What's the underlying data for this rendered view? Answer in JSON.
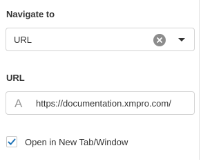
{
  "navigate_section": {
    "label": "Navigate to",
    "selected_value": "URL",
    "clear_icon": "clear-circle-icon",
    "dropdown_icon": "chevron-down-icon"
  },
  "url_section": {
    "label": "URL",
    "field_type_icon": "A",
    "value": "https://documentation.xmpro.com/"
  },
  "open_new_tab": {
    "label": "Open in New Tab/Window",
    "checked": true
  },
  "colors": {
    "accent": "#1f73b7",
    "text": "#333333",
    "border": "#d3d3d3",
    "icon_gray": "#8c8c8c"
  }
}
